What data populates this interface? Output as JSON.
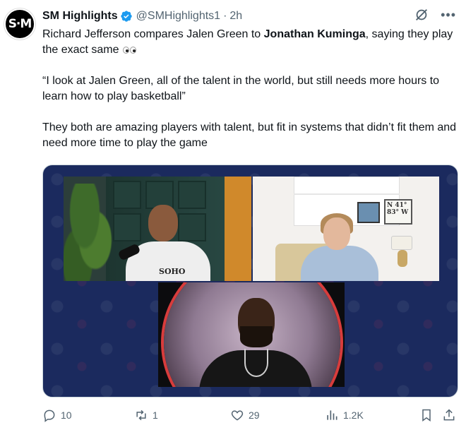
{
  "author": {
    "display_name": "SM Highlights",
    "handle": "@SMHighlights1",
    "separator": "·",
    "time": "2h",
    "avatar_text": "S·M",
    "verified": true
  },
  "tweet": {
    "line1_prefix": "Richard Jefferson compares Jalen Green to ",
    "line1_bold": "Jonathan Kuminga",
    "line1_suffix": ", saying they play the exact same",
    "paragraph2": "“I look at Jalen Green, all of the talent in the world, but still needs more hours to learn how to play basketball”",
    "paragraph3": "They both are amazing players with talent, but fit in systems that didn’t fit them and need more time to play the game"
  },
  "media": {
    "shirt_text": "SOHO",
    "sign_text": "N 41° 83° W"
  },
  "actions": {
    "replies": "10",
    "reposts": "1",
    "likes": "29",
    "views": "1.2K"
  },
  "colors": {
    "verified_blue": "#1d9bf0",
    "muted_text": "#536471",
    "primary_text": "#0f1419",
    "media_bg": "#1b2a5e"
  },
  "icons": [
    "verified-badge-icon",
    "grok-icon",
    "more-icon",
    "reply-icon",
    "repost-icon",
    "like-icon",
    "views-icon",
    "bookmark-icon",
    "share-icon"
  ]
}
